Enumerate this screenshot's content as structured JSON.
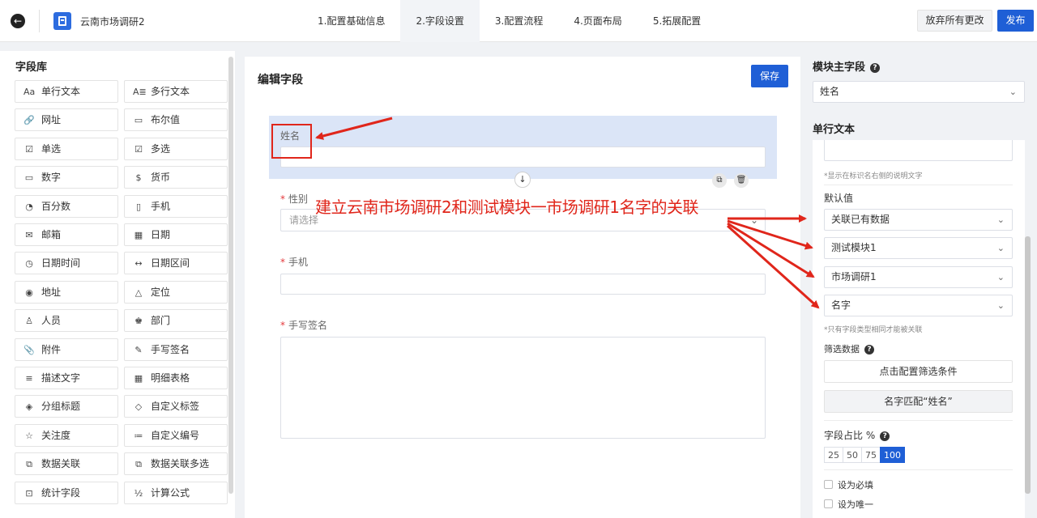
{
  "header": {
    "app_title": "云南市场调研2",
    "steps": [
      "1.配置基础信息",
      "2.字段设置",
      "3.配置流程",
      "4.页面布局",
      "5.拓展配置"
    ],
    "active_step": 1,
    "discard_label": "放弃所有更改",
    "publish_label": "发布"
  },
  "library": {
    "title": "字段库",
    "items": [
      {
        "icon": "Aa",
        "label": "单行文本"
      },
      {
        "icon": "A≣",
        "label": "多行文本"
      },
      {
        "icon": "🔗",
        "label": "网址"
      },
      {
        "icon": "▭",
        "label": "布尔值"
      },
      {
        "icon": "☑",
        "label": "单选"
      },
      {
        "icon": "☑",
        "label": "多选"
      },
      {
        "icon": "▭",
        "label": "数字"
      },
      {
        "icon": "$",
        "label": "货币"
      },
      {
        "icon": "◔",
        "label": "百分数"
      },
      {
        "icon": "▯",
        "label": "手机"
      },
      {
        "icon": "✉",
        "label": "邮箱"
      },
      {
        "icon": "▦",
        "label": "日期"
      },
      {
        "icon": "◷",
        "label": "日期时间"
      },
      {
        "icon": "↔",
        "label": "日期区间"
      },
      {
        "icon": "◉",
        "label": "地址"
      },
      {
        "icon": "△",
        "label": "定位"
      },
      {
        "icon": "♙",
        "label": "人员"
      },
      {
        "icon": "♚",
        "label": "部门"
      },
      {
        "icon": "📎",
        "label": "附件"
      },
      {
        "icon": "✎",
        "label": "手写签名"
      },
      {
        "icon": "≡",
        "label": "描述文字"
      },
      {
        "icon": "▦",
        "label": "明细表格"
      },
      {
        "icon": "◈",
        "label": "分组标题"
      },
      {
        "icon": "◇",
        "label": "自定义标签"
      },
      {
        "icon": "☆",
        "label": "关注度"
      },
      {
        "icon": "≔",
        "label": "自定义编号"
      },
      {
        "icon": "⧉",
        "label": "数据关联"
      },
      {
        "icon": "⧉",
        "label": "数据关联多选"
      },
      {
        "icon": "⊡",
        "label": "统计字段"
      },
      {
        "icon": "½",
        "label": "计算公式"
      }
    ]
  },
  "editor": {
    "title": "编辑字段",
    "save_label": "保存",
    "fields": [
      {
        "label": "姓名",
        "required": false,
        "selected": true
      },
      {
        "label": "性别",
        "required": true,
        "placeholder": "请选择"
      },
      {
        "label": "手机",
        "required": true
      },
      {
        "label": "手写签名",
        "required": true
      }
    ]
  },
  "annotation": {
    "text": "建立云南市场调研2和测试模块一市场调研1名字的关联"
  },
  "right_panel": {
    "main_field_title": "模块主字段",
    "main_field_value": "姓名",
    "type_title": "单行文本",
    "desc_hint": "*显示在标识名右侧的说明文字",
    "default_label": "默认值",
    "default_type": "关联已有数据",
    "module": "测试模块1",
    "form": "市场调研1",
    "field": "名字",
    "same_type_hint": "*只有字段类型相同才能被关联",
    "filter_label": "筛选数据",
    "filter_button": "点击配置筛选条件",
    "match_button": "名字匹配“姓名”",
    "width_label": "字段占比 %",
    "width_options": [
      "25",
      "50",
      "75",
      "100"
    ],
    "width_selected": "100",
    "required_label": "设为必填",
    "unique_label": "设为唯一"
  }
}
